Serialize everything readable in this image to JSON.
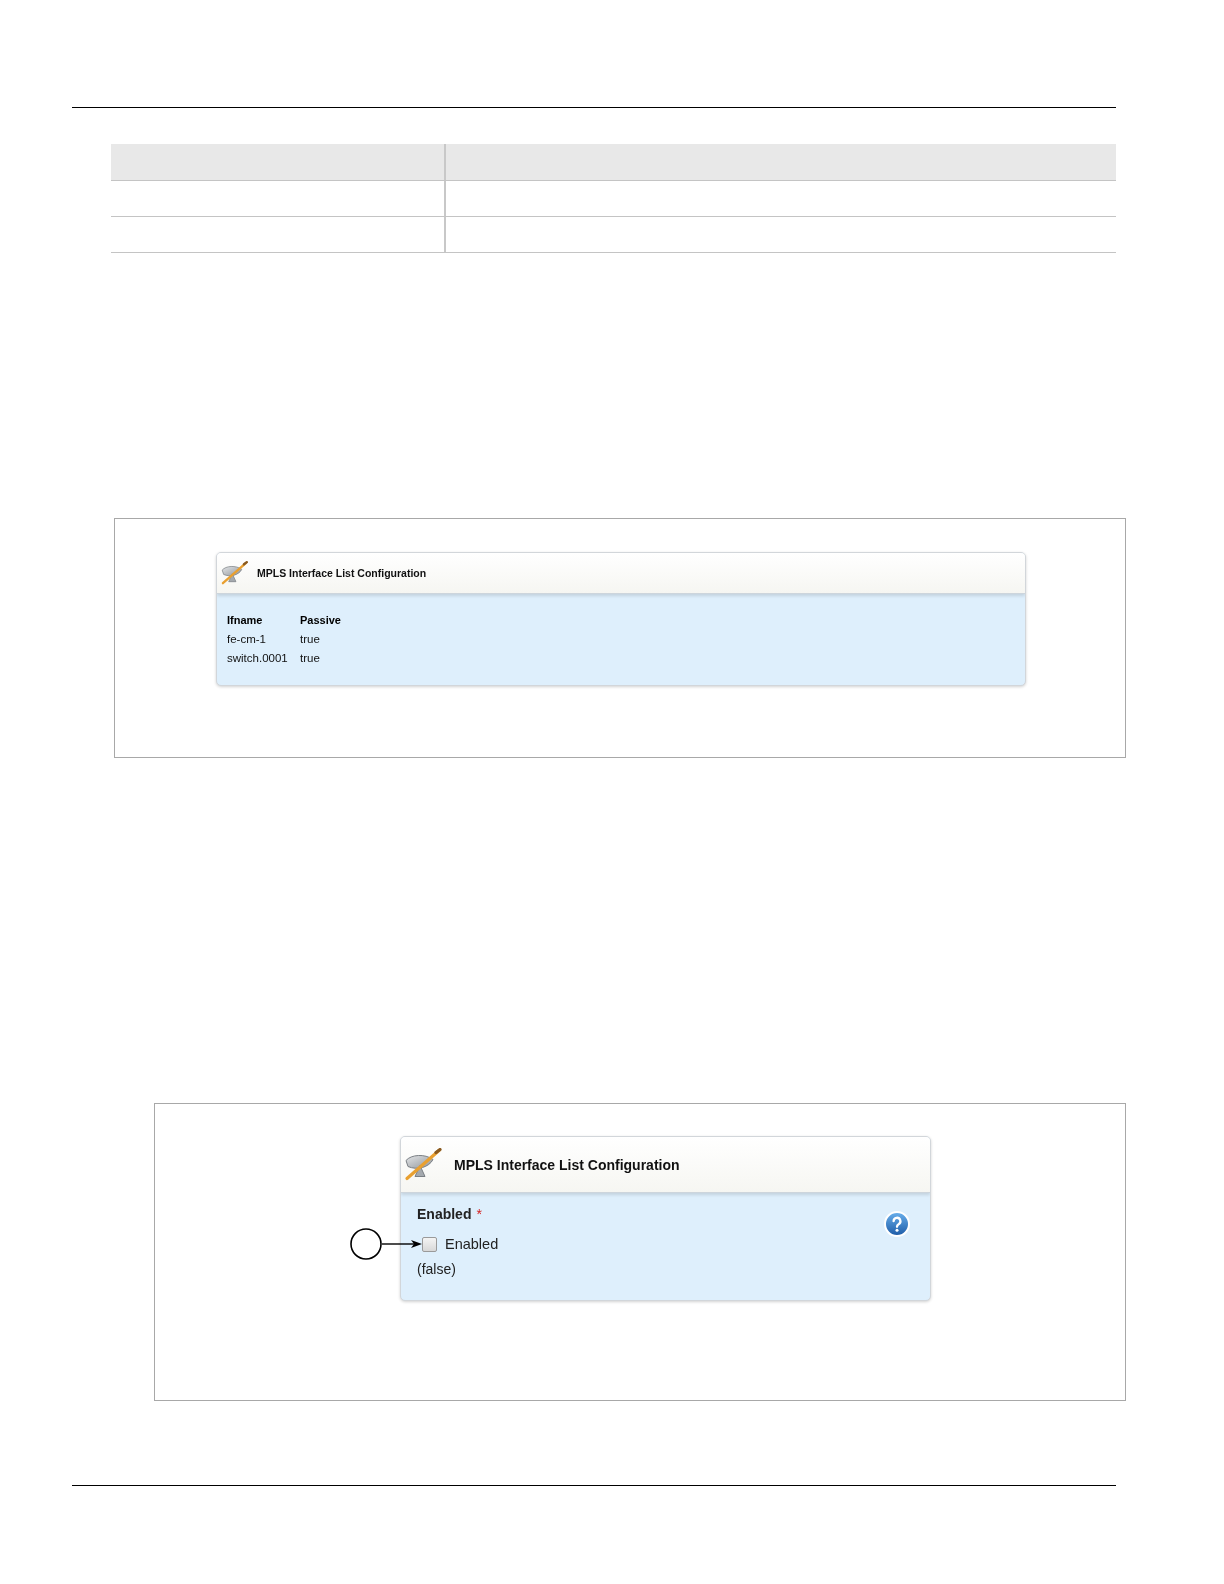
{
  "figures": [
    {
      "kind": "list",
      "panel": {
        "title": "MPLS Interface List Configuration",
        "columns": [
          "Ifname",
          "Passive"
        ],
        "rows": [
          [
            "fe-cm-1",
            "true"
          ],
          [
            "switch.0001",
            "true"
          ]
        ]
      }
    },
    {
      "kind": "form",
      "panel": {
        "title": "MPLS Interface List Configuration",
        "field": {
          "label": "Enabled",
          "required_mark": "*",
          "checkbox_label": "Enabled",
          "checked": false,
          "value": "(false)"
        }
      }
    }
  ]
}
